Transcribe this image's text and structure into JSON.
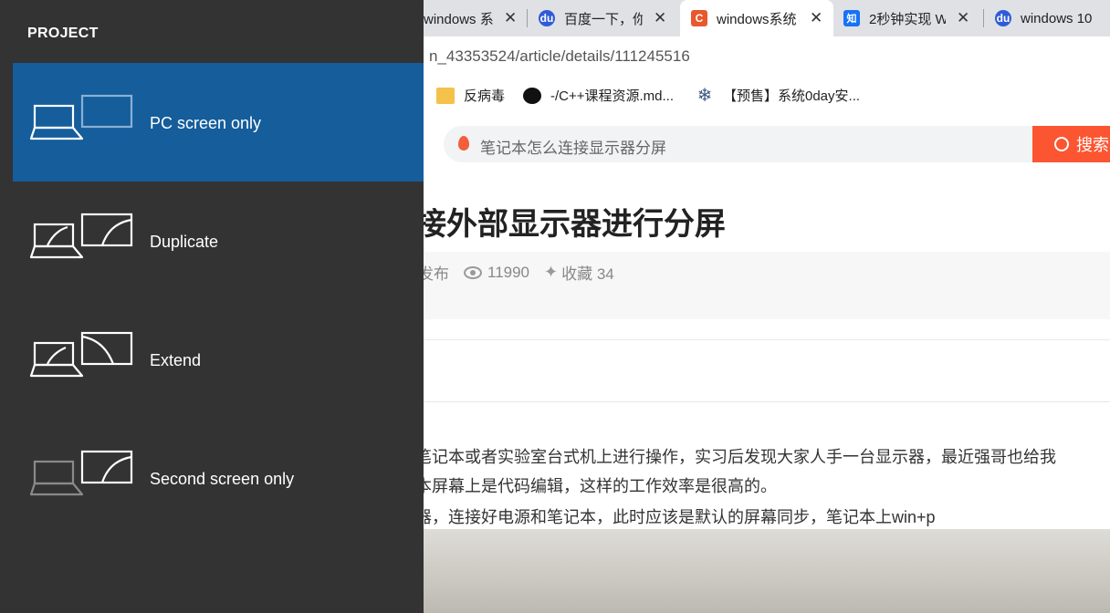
{
  "browser": {
    "tabs": [
      {
        "label": "windows 系统",
        "favicon": "csdn-icon"
      },
      {
        "label": "百度一下，你",
        "favicon": "baidu-icon"
      },
      {
        "label": "windows系统",
        "favicon": "csdn-icon",
        "active": true
      },
      {
        "label": "2秒钟实现 W",
        "favicon": "zhihu-icon"
      },
      {
        "label": "windows 10",
        "favicon": "baidu-icon"
      }
    ],
    "favicon_glyphs": {
      "csdn": "C",
      "zhihu": "知",
      "baidu": "du"
    },
    "url": "n_43353524/article/details/111245516",
    "bookmarks": [
      {
        "label": "反病毒",
        "icon": "folder-icon"
      },
      {
        "label": "-/C++课程资源.md...",
        "icon": "github-icon"
      },
      {
        "label": "【预售】系统0day安...",
        "icon": "snowflake-icon"
      }
    ],
    "search": {
      "placeholder": "笔记本怎么连接显示器分屏",
      "button": "搜索"
    },
    "article": {
      "title": "接外部显示器进行分屏",
      "meta": {
        "published": "发布",
        "views": "11990",
        "favorites": "收藏 34"
      },
      "paragraphs": [
        "笔记本或者实验室台式机上进行操作，实习后发现大家人手一台显示器，最近强哥也给我",
        "本屏幕上是代码编辑，这样的工作效率是很高的。",
        "器，连接好电源和笔记本，此时应该是默认的屏幕同步，笔记本上win+p"
      ]
    },
    "colors": {
      "accent": "#fc5531",
      "tabbar": "#dfe1e5"
    }
  },
  "project": {
    "header": "PROJECT",
    "options": [
      {
        "label": "PC screen only",
        "icon": "pc-screen-only-icon",
        "selected": true
      },
      {
        "label": "Duplicate",
        "icon": "duplicate-icon",
        "selected": false
      },
      {
        "label": "Extend",
        "icon": "extend-icon",
        "selected": false
      },
      {
        "label": "Second screen only",
        "icon": "second-screen-only-icon",
        "selected": false
      }
    ],
    "colors": {
      "panel": "#333333",
      "selected": "#155d9b"
    }
  }
}
